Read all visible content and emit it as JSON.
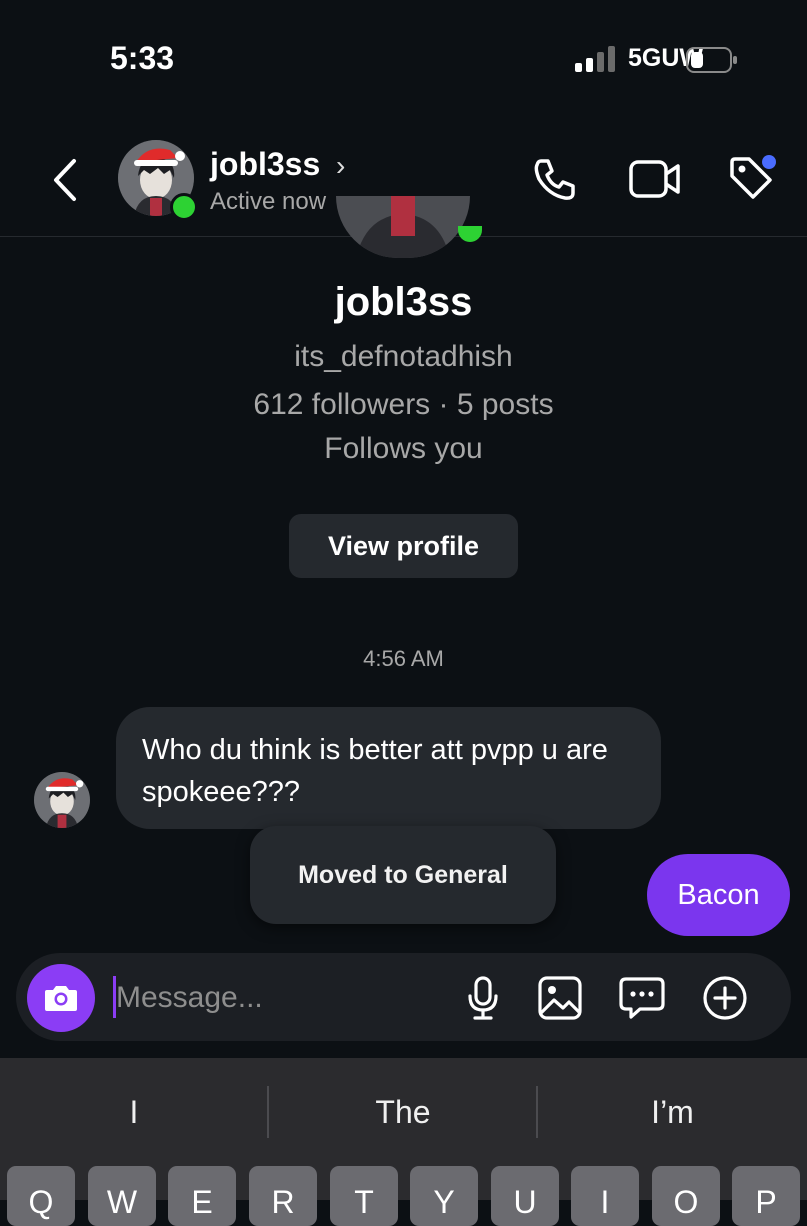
{
  "status_bar": {
    "time": "5:33",
    "network": "5GUW"
  },
  "header": {
    "name": "jobl3ss",
    "chevron": "›",
    "status": "Active now"
  },
  "profile": {
    "name": "jobl3ss",
    "username": "its_defnotadhish",
    "stats": "612 followers · 5 posts",
    "follows": "Follows you",
    "view_profile_label": "View profile"
  },
  "messages": {
    "timestamp": "4:56 AM",
    "incoming_text": "Who du think is better att pvpp u are spokeee???",
    "toast": "Moved to General",
    "outgoing_text": "Bacon"
  },
  "composer": {
    "placeholder": "Message..."
  },
  "keyboard": {
    "suggestions": [
      "I",
      "The",
      "I’m"
    ],
    "keys": [
      "Q",
      "W",
      "E",
      "R",
      "T",
      "Y",
      "U",
      "I",
      "O",
      "P"
    ]
  },
  "colors": {
    "background": "#0c1014",
    "online": "#2dd233",
    "accent": "#8b3df5",
    "outgoing_bubble": "#7b36ee",
    "notification_dot": "#4a6cff"
  },
  "icons": [
    "back-arrow-icon",
    "phone-icon",
    "video-icon",
    "tag-icon",
    "camera-icon",
    "microphone-icon",
    "image-icon",
    "sticker-icon",
    "plus-circle-icon"
  ]
}
